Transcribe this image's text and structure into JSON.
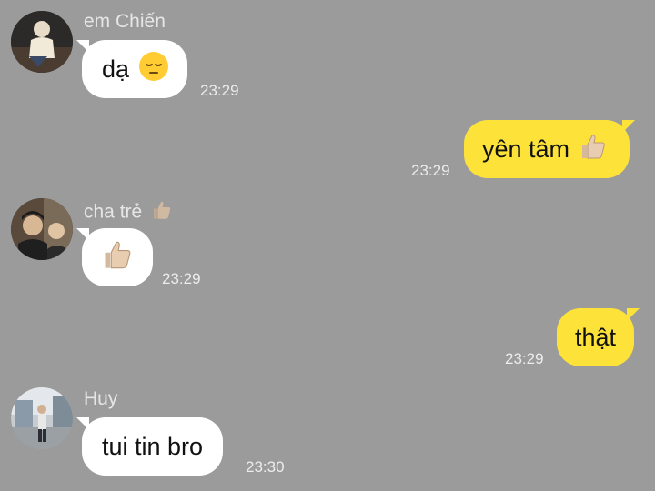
{
  "messages": [
    {
      "sender": "em Chiến",
      "text": "dạ",
      "emoji": "pensive-face",
      "time": "23:29",
      "direction": "incoming"
    },
    {
      "text": "yên tâm",
      "emoji": "thumbs-up",
      "time": "23:29",
      "direction": "outgoing"
    },
    {
      "sender": "cha trẻ",
      "sender_emoji": "thumbs-up",
      "text": "",
      "emoji": "thumbs-up",
      "time": "23:29",
      "direction": "incoming"
    },
    {
      "text": "thật",
      "time": "23:29",
      "direction": "outgoing"
    },
    {
      "sender": "Huy",
      "text": "tui tin bro",
      "time": "23:30",
      "direction": "incoming"
    }
  ],
  "colors": {
    "background": "#9b9b9b",
    "incoming_bubble": "#ffffff",
    "outgoing_bubble": "#fde23a",
    "meta_text": "#e6e6e6"
  }
}
